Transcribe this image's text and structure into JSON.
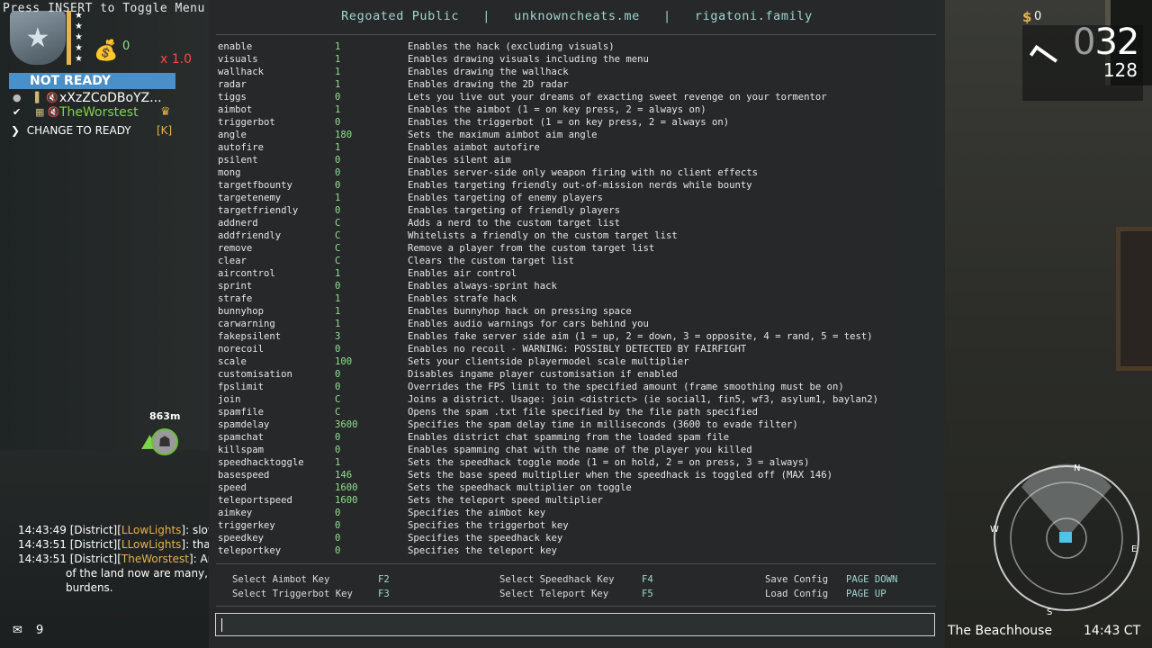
{
  "header": {
    "toggle_hint": "Press INSERT to Toggle Menu",
    "title": "Regoated Public   |   unknowncheats.me   |   rigatoni.family"
  },
  "commands": [
    {
      "name": "enable",
      "value": "1",
      "desc": "Enables the hack (excluding visuals)"
    },
    {
      "name": "visuals",
      "value": "1",
      "desc": "Enables drawing visuals including the menu"
    },
    {
      "name": "wallhack",
      "value": "1",
      "desc": "Enables drawing the wallhack"
    },
    {
      "name": "radar",
      "value": "1",
      "desc": "Enables drawing the 2D radar"
    },
    {
      "name": "tiggs",
      "value": "0",
      "desc": "Lets you live out your dreams of exacting sweet revenge on your tormentor"
    },
    {
      "name": "aimbot",
      "value": "1",
      "desc": "Enables the aimbot (1 = on key press, 2 = always on)"
    },
    {
      "name": "triggerbot",
      "value": "0",
      "desc": "Enables the triggerbot (1 = on key press, 2 = always on)"
    },
    {
      "name": "angle",
      "value": "180",
      "desc": "Sets the maximum aimbot aim angle"
    },
    {
      "name": "autofire",
      "value": "1",
      "desc": "Enables aimbot autofire"
    },
    {
      "name": "psilent",
      "value": "0",
      "desc": "Enables silent aim"
    },
    {
      "name": "mong",
      "value": "0",
      "desc": "Enables server-side only weapon firing with no client effects"
    },
    {
      "name": "targetfbounty",
      "value": "0",
      "desc": "Enables targeting friendly out-of-mission nerds while bounty"
    },
    {
      "name": "targetenemy",
      "value": "1",
      "desc": "Enables targeting of enemy players"
    },
    {
      "name": "targetfriendly",
      "value": "0",
      "desc": "Enables targeting of friendly players"
    },
    {
      "name": "addnerd",
      "value": "C",
      "desc": "Adds a nerd to the custom target list"
    },
    {
      "name": "addfriendly",
      "value": "C",
      "desc": "Whitelists a friendly on the custom target list"
    },
    {
      "name": "remove",
      "value": "C",
      "desc": "Remove a player from the custom target list"
    },
    {
      "name": "clear",
      "value": "C",
      "desc": "Clears the custom target list"
    },
    {
      "name": "aircontrol",
      "value": "1",
      "desc": "Enables air control"
    },
    {
      "name": "sprint",
      "value": "0",
      "desc": "Enables always-sprint hack"
    },
    {
      "name": "strafe",
      "value": "1",
      "desc": "Enables strafe hack"
    },
    {
      "name": "bunnyhop",
      "value": "1",
      "desc": "Enables bunnyhop hack on pressing space"
    },
    {
      "name": "carwarning",
      "value": "1",
      "desc": "Enables audio warnings for cars behind you"
    },
    {
      "name": "fakepsilent",
      "value": "3",
      "desc": "Enables fake server side aim (1 = up, 2 = down, 3 = opposite, 4 = rand, 5 = test)"
    },
    {
      "name": "norecoil",
      "value": "0",
      "desc": "Enables no recoil - WARNING: POSSIBLY DETECTED BY FAIRFIGHT"
    },
    {
      "name": "scale",
      "value": "100",
      "desc": "Sets your clientside playermodel scale multiplier"
    },
    {
      "name": "customisation",
      "value": "0",
      "desc": "Disables ingame player customisation if enabled"
    },
    {
      "name": "fpslimit",
      "value": "0",
      "desc": "Overrides the FPS limit to the specified amount (frame smoothing must be on)"
    },
    {
      "name": "join",
      "value": "C",
      "desc": "Joins a district. Usage: join <district> (ie social1, fin5, wf3, asylum1, baylan2)"
    },
    {
      "name": "spamfile",
      "value": "C",
      "desc": "Opens the spam .txt file specified by the file path specified"
    },
    {
      "name": "spamdelay",
      "value": "3600",
      "desc": "Specifies the spam delay time in milliseconds (3600 to evade filter)"
    },
    {
      "name": "spamchat",
      "value": "0",
      "desc": "Enables district chat spamming from the loaded spam file"
    },
    {
      "name": "killspam",
      "value": "0",
      "desc": "Enables spamming chat with the name of the player you killed"
    },
    {
      "name": "speedhacktoggle",
      "value": "1",
      "desc": "Sets the speedhack toggle mode (1 = on hold, 2 = on press, 3 = always)"
    },
    {
      "name": "basespeed",
      "value": "146",
      "desc": "Sets the base speed multiplier when the speedhack is toggled off (MAX 146)"
    },
    {
      "name": "speed",
      "value": "1600",
      "desc": "Sets the speedhack multiplier on toggle"
    },
    {
      "name": "teleportspeed",
      "value": "1600",
      "desc": "Sets the teleport speed multiplier"
    },
    {
      "name": "aimkey",
      "value": "0",
      "desc": "Specifies the aimbot key"
    },
    {
      "name": "triggerkey",
      "value": "0",
      "desc": "Specifies the triggerbot key"
    },
    {
      "name": "speedkey",
      "value": "0",
      "desc": "Specifies the speedhack key"
    },
    {
      "name": "teleportkey",
      "value": "0",
      "desc": "Specifies the teleport key"
    }
  ],
  "keybinds": [
    {
      "label": "Select Aimbot Key",
      "key": "F2"
    },
    {
      "label": "Select Triggerbot Key",
      "key": "F3"
    },
    {
      "label": "Select Speedhack Key",
      "key": "F4"
    },
    {
      "label": "Select Teleport Key",
      "key": "F5"
    },
    {
      "label": "Save Config",
      "key": "PAGE DOWN"
    },
    {
      "label": "Load Config",
      "key": "PAGE UP"
    }
  ],
  "console_input": {
    "value": ""
  },
  "left_hud": {
    "money": "0",
    "multiplier": "x 1.0",
    "ready_status": "NOT READY",
    "players": [
      {
        "name": "xXzZCoDBoYZ...",
        "color": "#ffffff"
      },
      {
        "name": "TheWorstest",
        "color": "#7ed44a"
      }
    ],
    "change_ready_label": "CHANGE TO READY",
    "change_ready_key": "[K]",
    "waypoint_distance": "863m"
  },
  "chat": [
    {
      "time": "14:43:49",
      "prefix": "[District][",
      "name": "LLowLights",
      "suffix": "]:  slow"
    },
    {
      "time": "14:43:51",
      "prefix": "[District][",
      "name": "LLowLights",
      "suffix": "]:  thank"
    },
    {
      "time": "14:43:51",
      "prefix": "[District][",
      "name": "TheWorstest",
      "suffix": "]:  And"
    }
  ],
  "chat_continuation": [
    "of the land now are many, an",
    "burdens."
  ],
  "mail_count": "9",
  "right_hud": {
    "cash": "0",
    "ammo_clip_dim": "0",
    "ammo_clip": "32",
    "ammo_total": "128",
    "location": "The Beachhouse",
    "clock": "14:43  CT"
  },
  "minimap": {
    "n": "N",
    "e": "E",
    "s": "S",
    "w": "W"
  }
}
